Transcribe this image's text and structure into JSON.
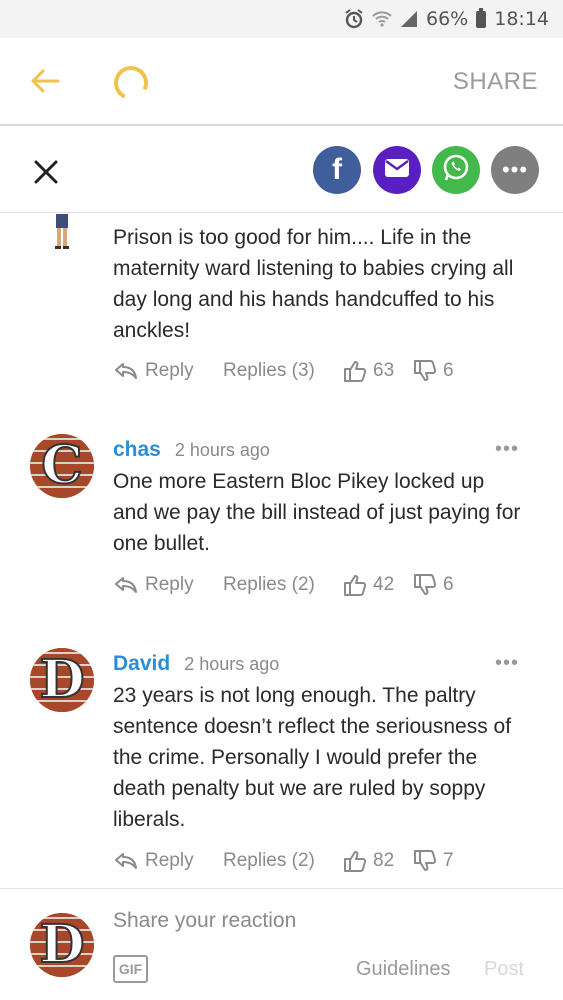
{
  "status_bar": {
    "battery": "66%",
    "time": "18:14"
  },
  "app_bar": {
    "share_label": "SHARE"
  },
  "share_overlay": {
    "facebook_glyph": "f",
    "more_glyph": "•••"
  },
  "comments": [
    {
      "username": "",
      "timestamp": "",
      "body": "Prison is too good for him.... Life in the maternity ward listening to babies crying all day long and his hands handcuffed to his anckles!",
      "reply_label": "Reply",
      "replies_label": "Replies (3)",
      "upvotes": "63",
      "downvotes": "6"
    },
    {
      "avatar_letter": "C",
      "username": "chas",
      "timestamp": "2 hours ago",
      "more_glyph": "•••",
      "body": "One more Eastern Bloc Pikey locked up and we pay the bill instead of just paying for one bullet.",
      "reply_label": "Reply",
      "replies_label": "Replies (2)",
      "upvotes": "42",
      "downvotes": "6"
    },
    {
      "avatar_letter": "D",
      "username": "David",
      "timestamp": "2 hours ago",
      "more_glyph": "•••",
      "body": "23 years is not long enough. The paltry sentence doesn’t reflect the seriousness of the crime. Personally I would prefer the death penalty but we are ruled by soppy liberals.",
      "reply_label": "Reply",
      "replies_label": "Replies (2)",
      "upvotes": "82",
      "downvotes": "7"
    }
  ],
  "composer": {
    "avatar_letter": "D",
    "placeholder": "Share your reaction",
    "gif_label": "GIF",
    "guidelines_label": "Guidelines",
    "post_label": "Post"
  },
  "colors": {
    "accent": "#f1c24a",
    "username": "#2b8fd8",
    "facebook": "#3f5e9b",
    "mail": "#5a1fc0",
    "whatsapp": "#43b94c"
  }
}
